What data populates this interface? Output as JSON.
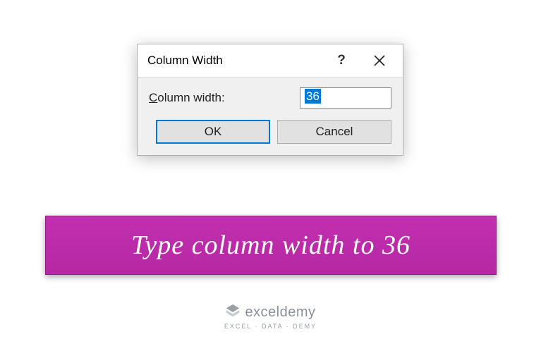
{
  "dialog": {
    "title": "Column Width",
    "field_label_underline": "C",
    "field_label_rest": "olumn width:",
    "input_value": "36",
    "ok_label": "OK",
    "cancel_label": "Cancel"
  },
  "caption": {
    "text": "Type column width to 36"
  },
  "logo": {
    "brand": "exceldemy",
    "tagline": "EXCEL · DATA · DEMY"
  }
}
